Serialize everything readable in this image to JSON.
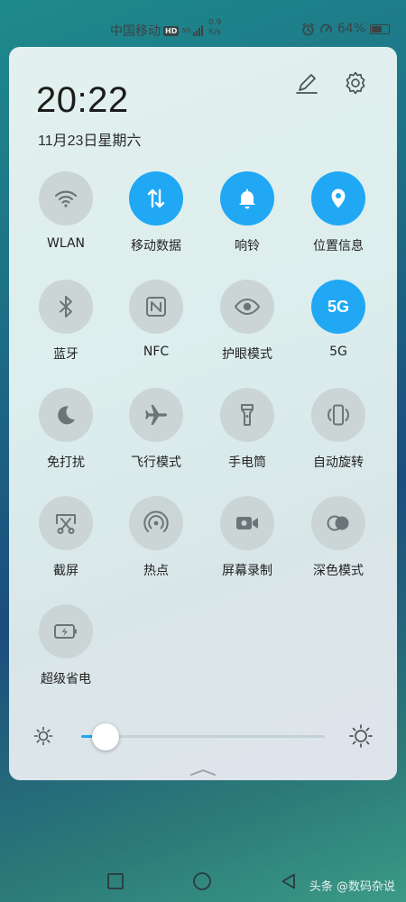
{
  "status_bar": {
    "carrier": "中国移动",
    "hd_badge": "HD",
    "network": "5G",
    "speed_value": "0.9",
    "speed_unit": "K/s",
    "battery_text": "64%",
    "battery_level": 0.64
  },
  "panel": {
    "time": "20:22",
    "date": "11月23日星期六"
  },
  "tiles": [
    {
      "label": "WLAN",
      "icon": "wifi-icon",
      "on": false
    },
    {
      "label": "移动数据",
      "icon": "mobile-data-icon",
      "on": true
    },
    {
      "label": "响铃",
      "icon": "bell-icon",
      "on": true
    },
    {
      "label": "位置信息",
      "icon": "location-icon",
      "on": true
    },
    {
      "label": "蓝牙",
      "icon": "bluetooth-icon",
      "on": false
    },
    {
      "label": "NFC",
      "icon": "nfc-icon",
      "on": false
    },
    {
      "label": "护眼模式",
      "icon": "eye-icon",
      "on": false
    },
    {
      "label": "5G",
      "icon": "5g-icon",
      "icon_text": "5G",
      "on": true
    },
    {
      "label": "免打扰",
      "icon": "moon-icon",
      "on": false
    },
    {
      "label": "飞行模式",
      "icon": "airplane-icon",
      "on": false
    },
    {
      "label": "手电筒",
      "icon": "flashlight-icon",
      "on": false
    },
    {
      "label": "自动旋转",
      "icon": "auto-rotate-icon",
      "on": false
    },
    {
      "label": "截屏",
      "icon": "screenshot-icon",
      "on": false
    },
    {
      "label": "热点",
      "icon": "hotspot-icon",
      "on": false
    },
    {
      "label": "屏幕录制",
      "icon": "screen-record-icon",
      "on": false
    },
    {
      "label": "深色模式",
      "icon": "dark-mode-icon",
      "on": false
    },
    {
      "label": "超级省电",
      "icon": "power-saving-icon",
      "on": false
    }
  ],
  "brightness": {
    "level": 0.1
  },
  "colors": {
    "accent": "#20a8f4",
    "tile_off": "#cbd5d6",
    "icon_off": "#6b7477"
  },
  "watermark": {
    "text": "头条 @数码杂说"
  }
}
